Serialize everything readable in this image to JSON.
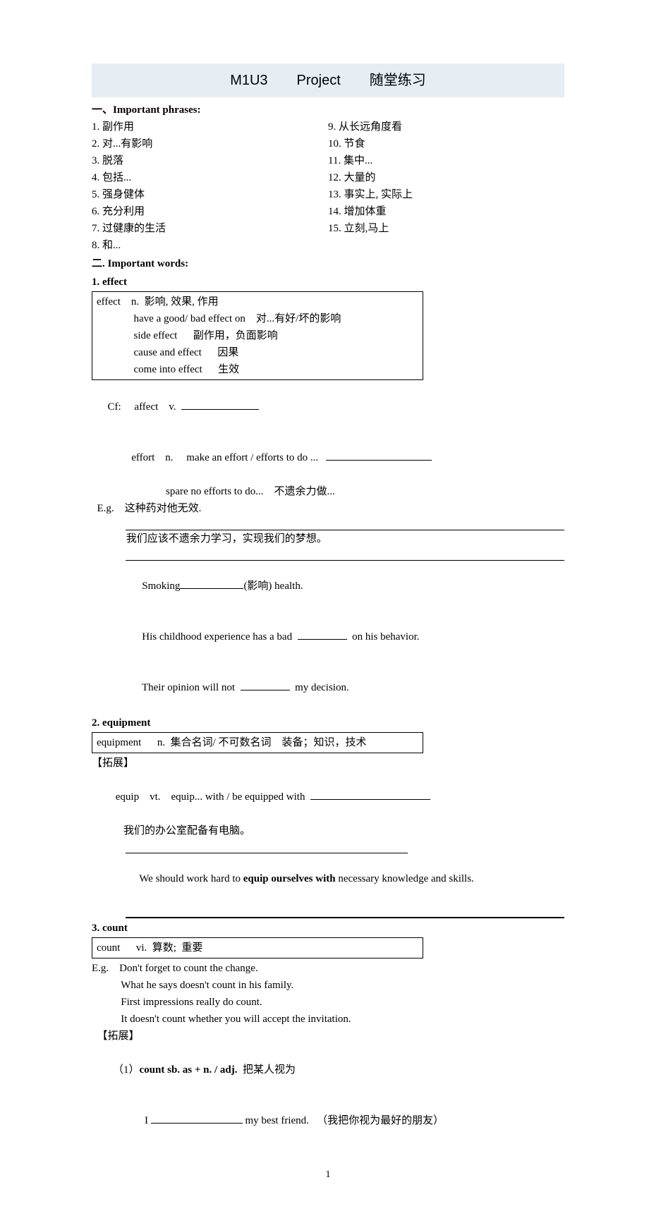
{
  "title": {
    "a": "M1U3",
    "b": "Project",
    "c": "随堂练习"
  },
  "sec1": {
    "head": "一、Important phrases:"
  },
  "phr_left": [
    "1. 副作用",
    "2. 对...有影响",
    "3. 脱落",
    "4. 包括...",
    "5. 强身健体",
    "6. 充分利用",
    "7. 过健康的生活",
    "8. 和..."
  ],
  "phr_right": [
    "9.  从长远角度看",
    "10.  节食",
    "11.  集中...",
    "12.  大量的",
    "13.  事实上,  实际上",
    "14.  增加体重",
    "15.  立刻,马上"
  ],
  "sec2": {
    "head": "二. Important words:"
  },
  "w1": {
    "num": "1. effect",
    "box": [
      "effect    n.  影响, 效果, 作用",
      "              have a good/ bad effect on    对...有好/坏的影响",
      "              side effect      副作用，负面影响",
      "              cause and effect      因果",
      "              come into effect      生效"
    ],
    "cf_label": "Cf:     affect    v.  ",
    "effort1": "         effort    n.     make an effort / efforts to do ...   ",
    "effort2": "                            spare no efforts to do...    不遗余力做...",
    "eg_label": "  E.g.    这种药对他无效.",
    "cn1": "             我们应该不遗余力学习，实现我们的梦想。",
    "sm_a": "             Smoking",
    "sm_b": "(影响) health.",
    "ch_a": "             His childhood experience has a bad  ",
    "ch_b": "  on his behavior.",
    "op_a": "             Their opinion will not  ",
    "op_b": "  my decision."
  },
  "w2": {
    "num": "2. equipment",
    "box": [
      "equipment      n.  集合名词/ 不可数名词    装备；知识，技术"
    ],
    "ext": "【拓展】",
    "eq_a": "   equip    vt.    equip... with / be equipped with  ",
    "cn": "            我们的办公室配备有电脑。",
    "en_a": "            We should work hard to ",
    "en_bold": "equip ourselves with",
    "en_b": " necessary knowledge and skills."
  },
  "w3": {
    "num": "3. count",
    "box": [
      "count      vi.  算数;  重要"
    ],
    "eg": [
      "E.g.    Don't forget to count the change.",
      "           What he says doesn't count in his family.",
      "           First impressions really do count.",
      "           It doesn't count whether you will accept the invitation."
    ],
    "ext": "  【拓展】",
    "c1_a": "  （1）",
    "c1_bold": "count sb. as + n. / adj.",
    "c1_b": "  把某人视为",
    "c1_line_a": "              I ",
    "c1_line_b": " my best friend.   （我把你视为最好的朋友）"
  },
  "page_no": "1"
}
